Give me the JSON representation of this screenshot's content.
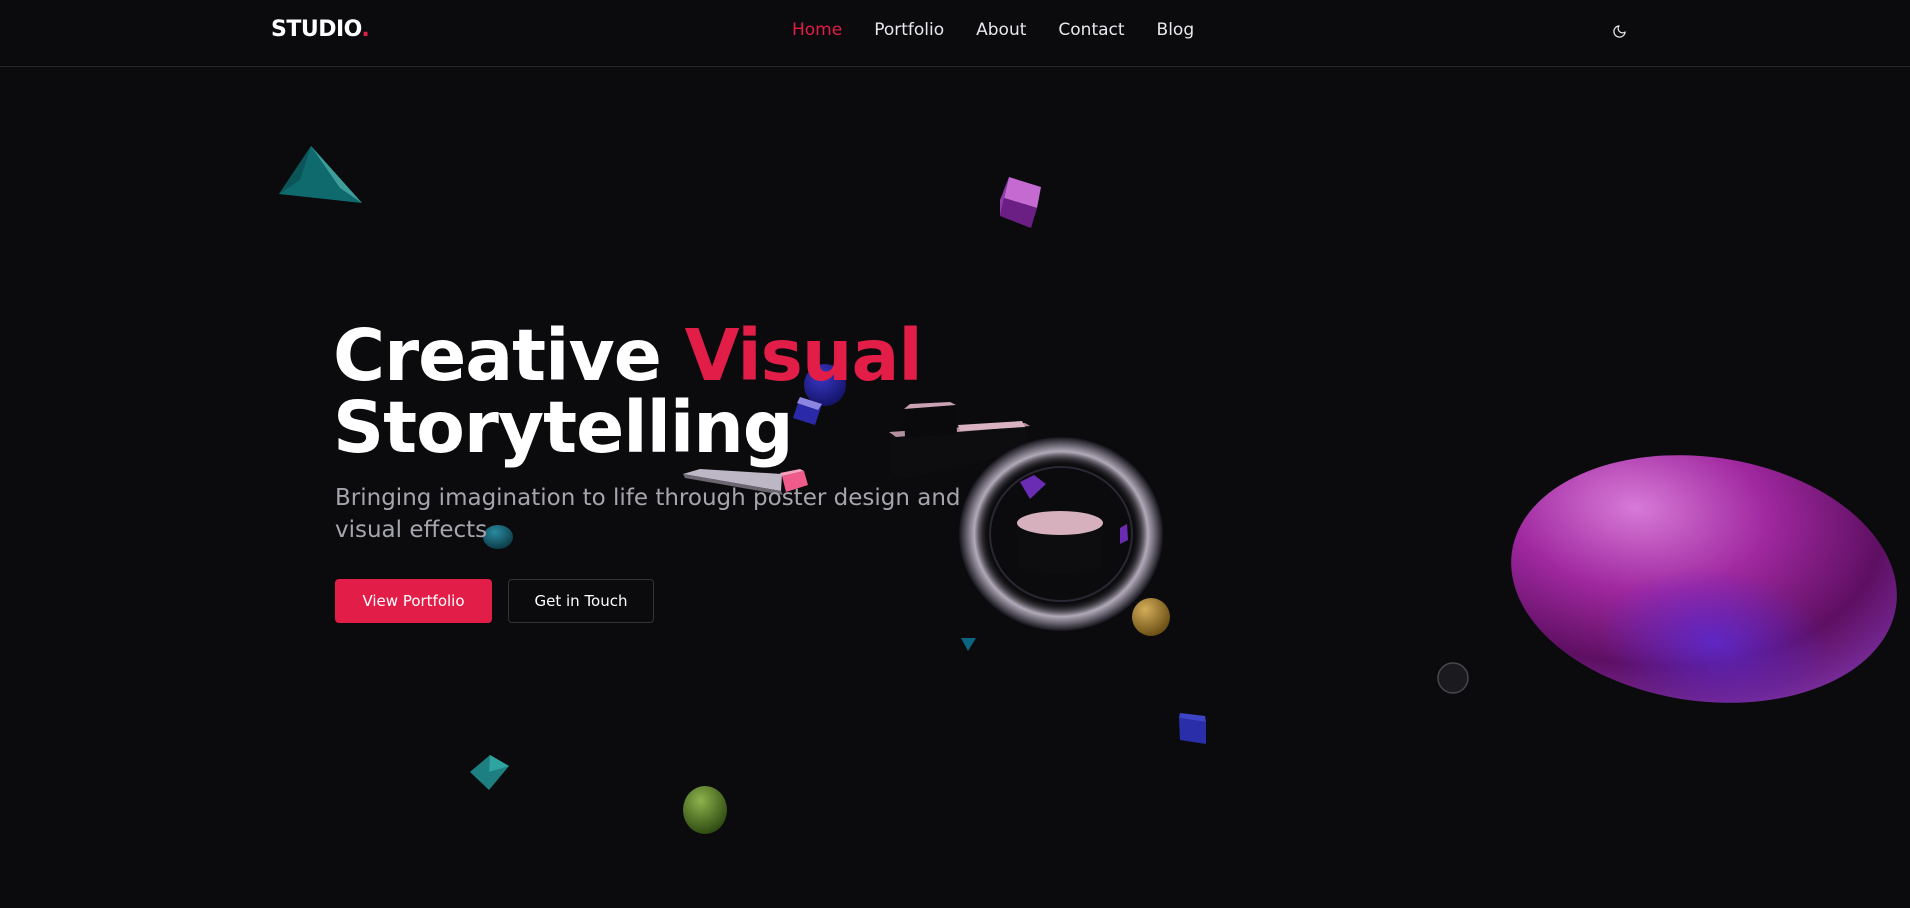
{
  "header": {
    "logo_text": "STUDIO",
    "logo_dot": ".",
    "nav": [
      {
        "label": "Home",
        "active": true
      },
      {
        "label": "Portfolio",
        "active": false
      },
      {
        "label": "About",
        "active": false
      },
      {
        "label": "Contact",
        "active": false
      },
      {
        "label": "Blog",
        "active": false
      }
    ],
    "theme_toggle_icon": "moon-icon"
  },
  "hero": {
    "title_part1": "Creative ",
    "title_accent": "Visual",
    "title_line2": "Storytelling",
    "subtitle": "Bringing imagination to life through poster design and visual effects",
    "primary_button": "View Portfolio",
    "secondary_button": "Get in Touch"
  },
  "colors": {
    "accent": "#e11d48",
    "background": "#0b0b0e",
    "text": "#ffffff",
    "muted_text": "#a5a5ad"
  }
}
